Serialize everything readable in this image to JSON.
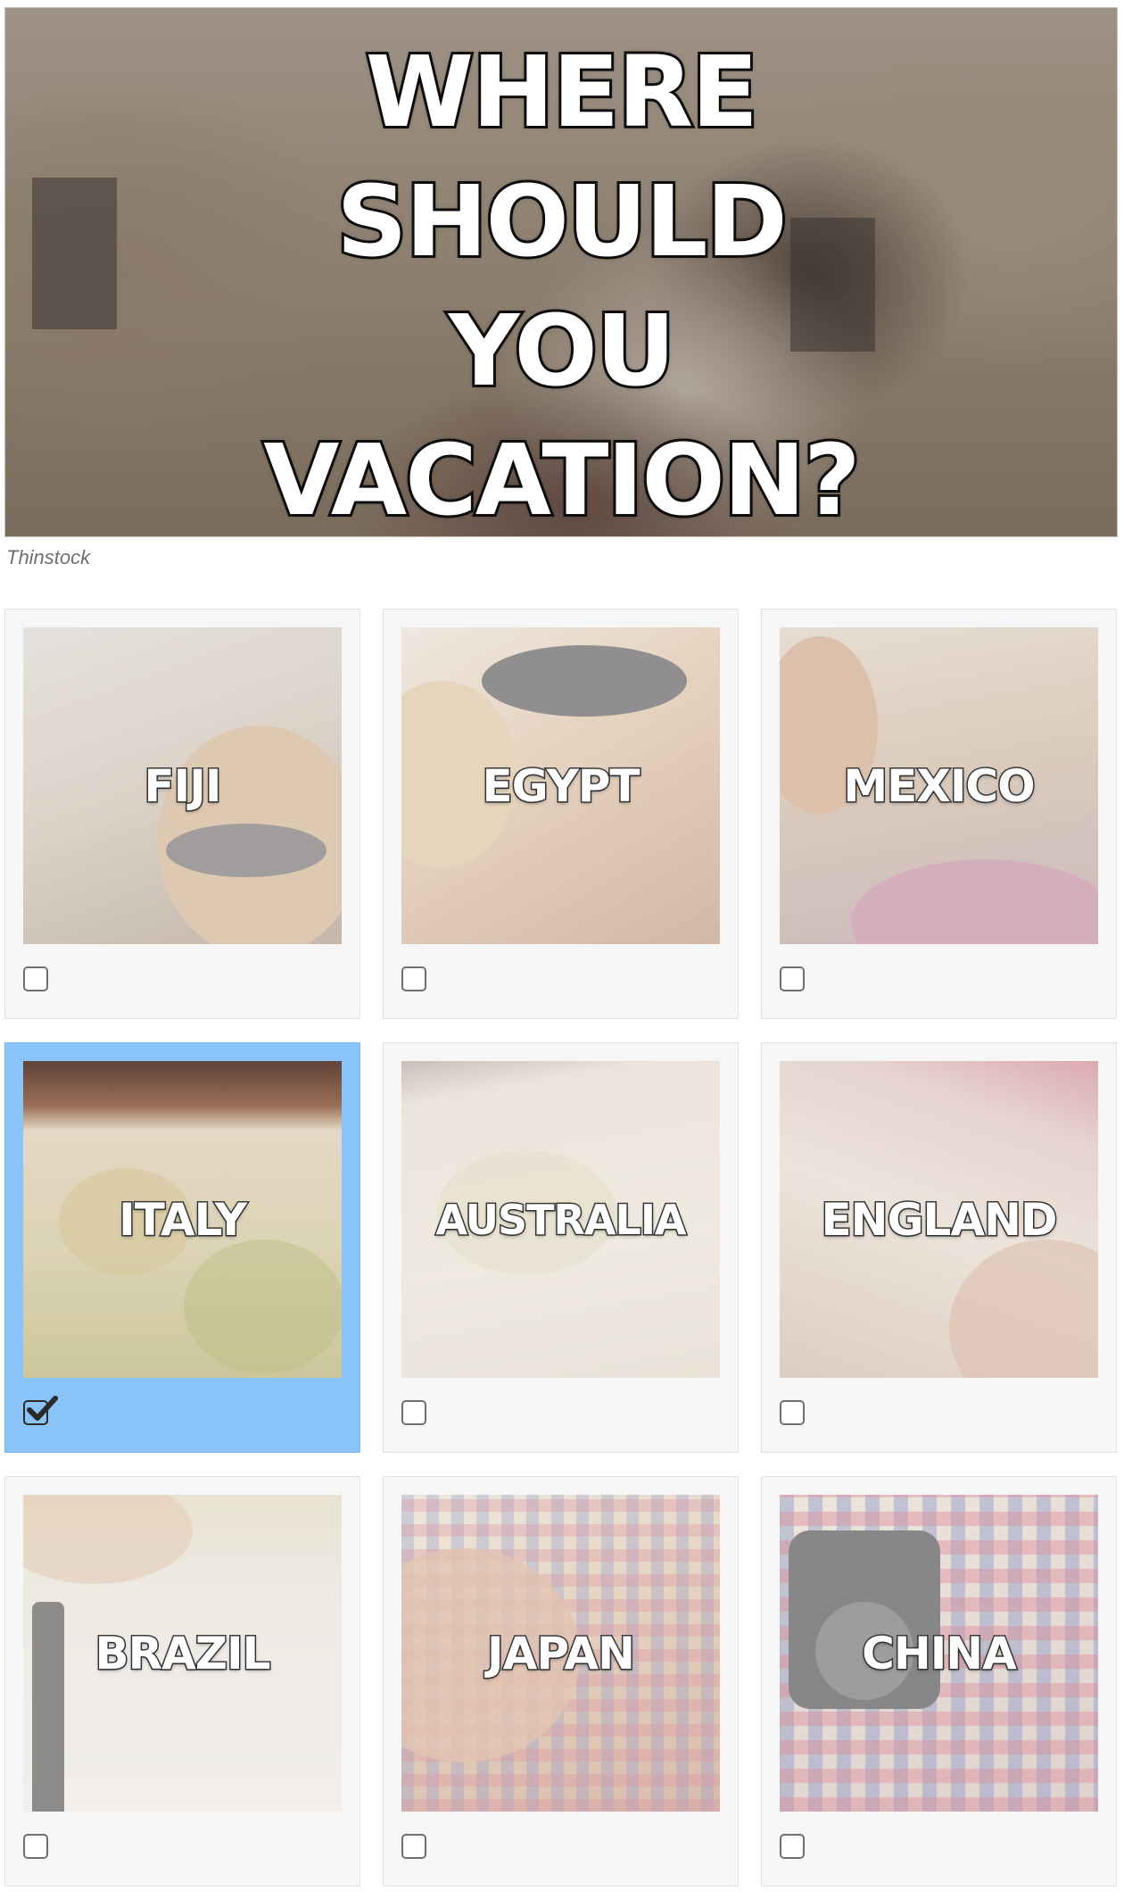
{
  "hero": {
    "title_lines": [
      "WHERE",
      "SHOULD",
      "YOU",
      "VACATION?"
    ],
    "credit": "Thinstock"
  },
  "options": [
    {
      "label": "FIJI",
      "selected": false
    },
    {
      "label": "EGYPT",
      "selected": false
    },
    {
      "label": "MEXICO",
      "selected": false
    },
    {
      "label": "ITALY",
      "selected": true
    },
    {
      "label": "AUSTRALIA",
      "selected": false
    },
    {
      "label": "ENGLAND",
      "selected": false
    },
    {
      "label": "BRAZIL",
      "selected": false
    },
    {
      "label": "JAPAN",
      "selected": false
    },
    {
      "label": "CHINA",
      "selected": false
    }
  ],
  "colors": {
    "selected_card": "#8ac3f8",
    "card_background": "#f6f6f6",
    "checkbox_border": "#6f6f6f"
  },
  "icons": {
    "unchecked": "checkbox-empty-icon",
    "checked": "checkbox-checked-icon"
  }
}
